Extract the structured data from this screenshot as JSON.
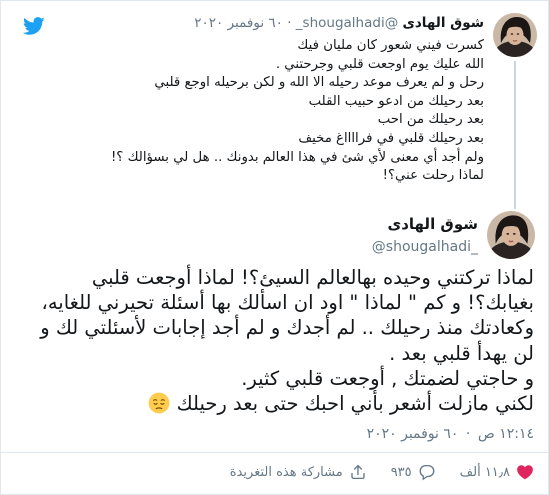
{
  "parent_tweet": {
    "display_name": "شوق الهادى",
    "handle": "@shougalhadi_",
    "separator": "·",
    "date": "٦٠ نوفمبر ٢٠٢٠",
    "lines": [
      "كسرت فيني شعور كان مليان فيك",
      "الله عليك يوم اوجعت قلبي وجرحتني .",
      "رحل و لم يعرف موعد رحيله الا الله و لكن برحيله اوجع قلبي",
      "بعد رحيلك من ادعو حبيب القلب",
      "بعد رحيلك من احب",
      "بعد رحيلك قلبي في فرااااغ مخيف",
      "ولم أجد أي معنى لأي شئ في هذا العالم بدونك .. هل لي بسؤالك ؟!",
      "لماذا رحلت عني؟!"
    ]
  },
  "main_tweet": {
    "display_name": "شوق الهادى",
    "handle": "@shougalhadi_",
    "lines": [
      "لماذا تركتني وحيده بهالعالم السيئ؟! لماذا أوجعت قلبي",
      "بغيابك؟! و كم \" لماذا \" اود ان اسألك بها أسئلة تحيرني للغايه،",
      "وكعادتك منذ رحيلك .. لم أجدك و لم أجد إجابات لأسئلتي لك و",
      "لن يهدأ قلبي بعد .",
      "و حاجتي لضمتك , أوجعت قلبي كثير.",
      "لكني مازلت أشعر بأني احبك حتى بعد رحيلك"
    ],
    "emoji": "pensive-face",
    "time": "١٢:١٤ ص",
    "separator": "·",
    "date": "٦٠ نوفمبر ٢٠٢٠"
  },
  "actions": {
    "likes": "١١٫٨ ألف",
    "replies": "٩٣٥",
    "share_label": "مشاركة هذه التغريدة"
  },
  "colors": {
    "twitter_blue": "#1da1f2",
    "like_red": "#e0245e",
    "secondary_text": "#657786"
  },
  "icons": [
    "twitter-logo-icon",
    "heart-icon",
    "reply-icon",
    "share-icon",
    "pensive-face-emoji-icon"
  ]
}
